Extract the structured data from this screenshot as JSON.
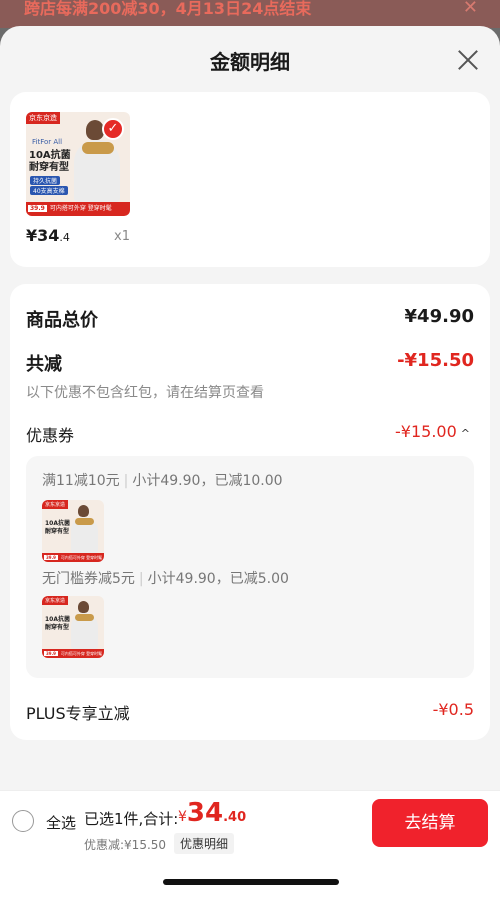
{
  "banner": {
    "text": "跨店每满200减30，4月13日24点结束",
    "close": "✕"
  },
  "sheet": {
    "title": "金额明细"
  },
  "product": {
    "thumb": {
      "brand": "京东京造",
      "en": "FitFor All",
      "title_line1": "10A抗菌",
      "title_line2": "耐穿有型",
      "pill1": "持久抗菌",
      "pill2": "40支高支棉",
      "promo_price": "39.9",
      "promo_text": "可内搭可外穿 登穿时髦"
    },
    "check": "✓",
    "price_int": "¥34",
    "price_dec": ".4",
    "qty": "x1"
  },
  "detail": {
    "total_label": "商品总价",
    "total_value": "¥49.90",
    "reduce_label": "共减",
    "reduce_value": "-¥15.50",
    "note": "以下优惠不包含红包，请在结算页查看",
    "coupon_label": "优惠券",
    "coupon_value": "-¥15.00",
    "coupon_caret": "^",
    "coupons": [
      {
        "rule": "满11减10元",
        "summary": "小计49.90，已减10.00"
      },
      {
        "rule": "无门槛券减5元",
        "summary": "小计49.90，已减5.00"
      }
    ],
    "plus_label": "PLUS专享立减",
    "plus_value": "-¥0.5"
  },
  "footer": {
    "select_all": "全选",
    "selected_text": "已选1件,合计:",
    "total_currency": "¥",
    "total_int": "34",
    "total_dec": ".40",
    "discount_note": "优惠减:¥15.50",
    "detail_tag": "优惠明细",
    "checkout": "去结算"
  },
  "colors": {
    "accent_red": "#e0261f",
    "checkout_red": "#f0222c",
    "navy_pill": "#2a56b0"
  }
}
